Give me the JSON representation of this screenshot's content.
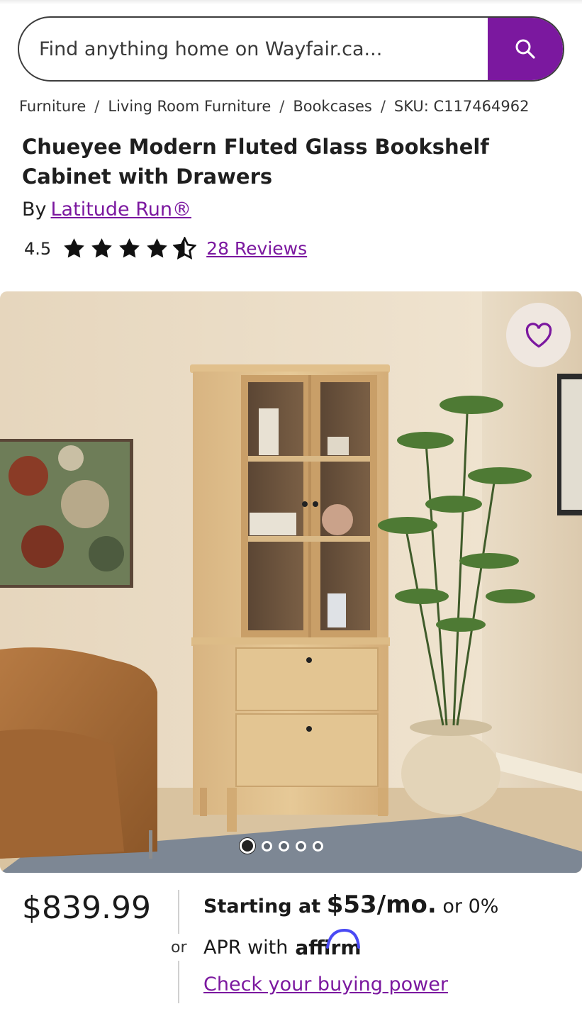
{
  "search": {
    "placeholder": "Find anything home on Wayfair.ca...",
    "button_icon": "search-icon"
  },
  "breadcrumb": {
    "items": [
      "Furniture",
      "Living Room Furniture",
      "Bookcases"
    ],
    "sku": "SKU: C117464962",
    "separator": "/"
  },
  "product": {
    "title": "Chueyee Modern Fluted Glass Bookshelf Cabinet with Drawers",
    "by_label": "By",
    "brand": "Latitude Run®",
    "rating": "4.5",
    "rating_value": 4.5,
    "reviews": "28 Reviews"
  },
  "gallery": {
    "image_count": 5,
    "active_index": 0,
    "favorite_icon": "heart-icon"
  },
  "pricing": {
    "price": "$839.99",
    "or_label": "or",
    "starting_at": "Starting at",
    "monthly": "$53/mo.",
    "or_zero": "or 0%",
    "apr_with": "APR with",
    "affirm": "affirm",
    "check_link": "Check your buying power"
  },
  "colors": {
    "brand_purple": "#7b189f"
  }
}
